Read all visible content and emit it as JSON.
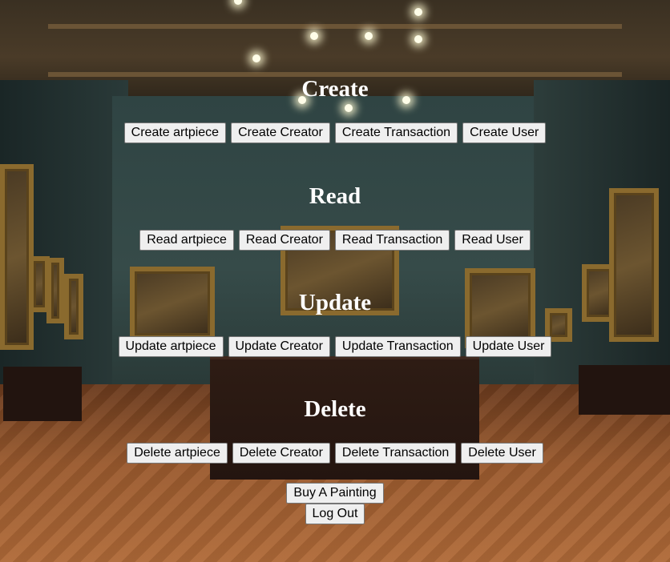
{
  "sections": [
    {
      "heading": "Create",
      "buttons": [
        "Create artpiece",
        "Create Creator",
        "Create Transaction",
        "Create User"
      ]
    },
    {
      "heading": "Read",
      "buttons": [
        "Read artpiece",
        "Read Creator",
        "Read Transaction",
        "Read User"
      ]
    },
    {
      "heading": "Update",
      "buttons": [
        "Update artpiece",
        "Update Creator",
        "Update Transaction",
        "Update User"
      ]
    },
    {
      "heading": "Delete",
      "buttons": [
        "Delete artpiece",
        "Delete Creator",
        "Delete Transaction",
        "Delete User"
      ]
    }
  ],
  "actions": {
    "buy_label": "Buy A Painting",
    "logout_label": "Log Out"
  }
}
